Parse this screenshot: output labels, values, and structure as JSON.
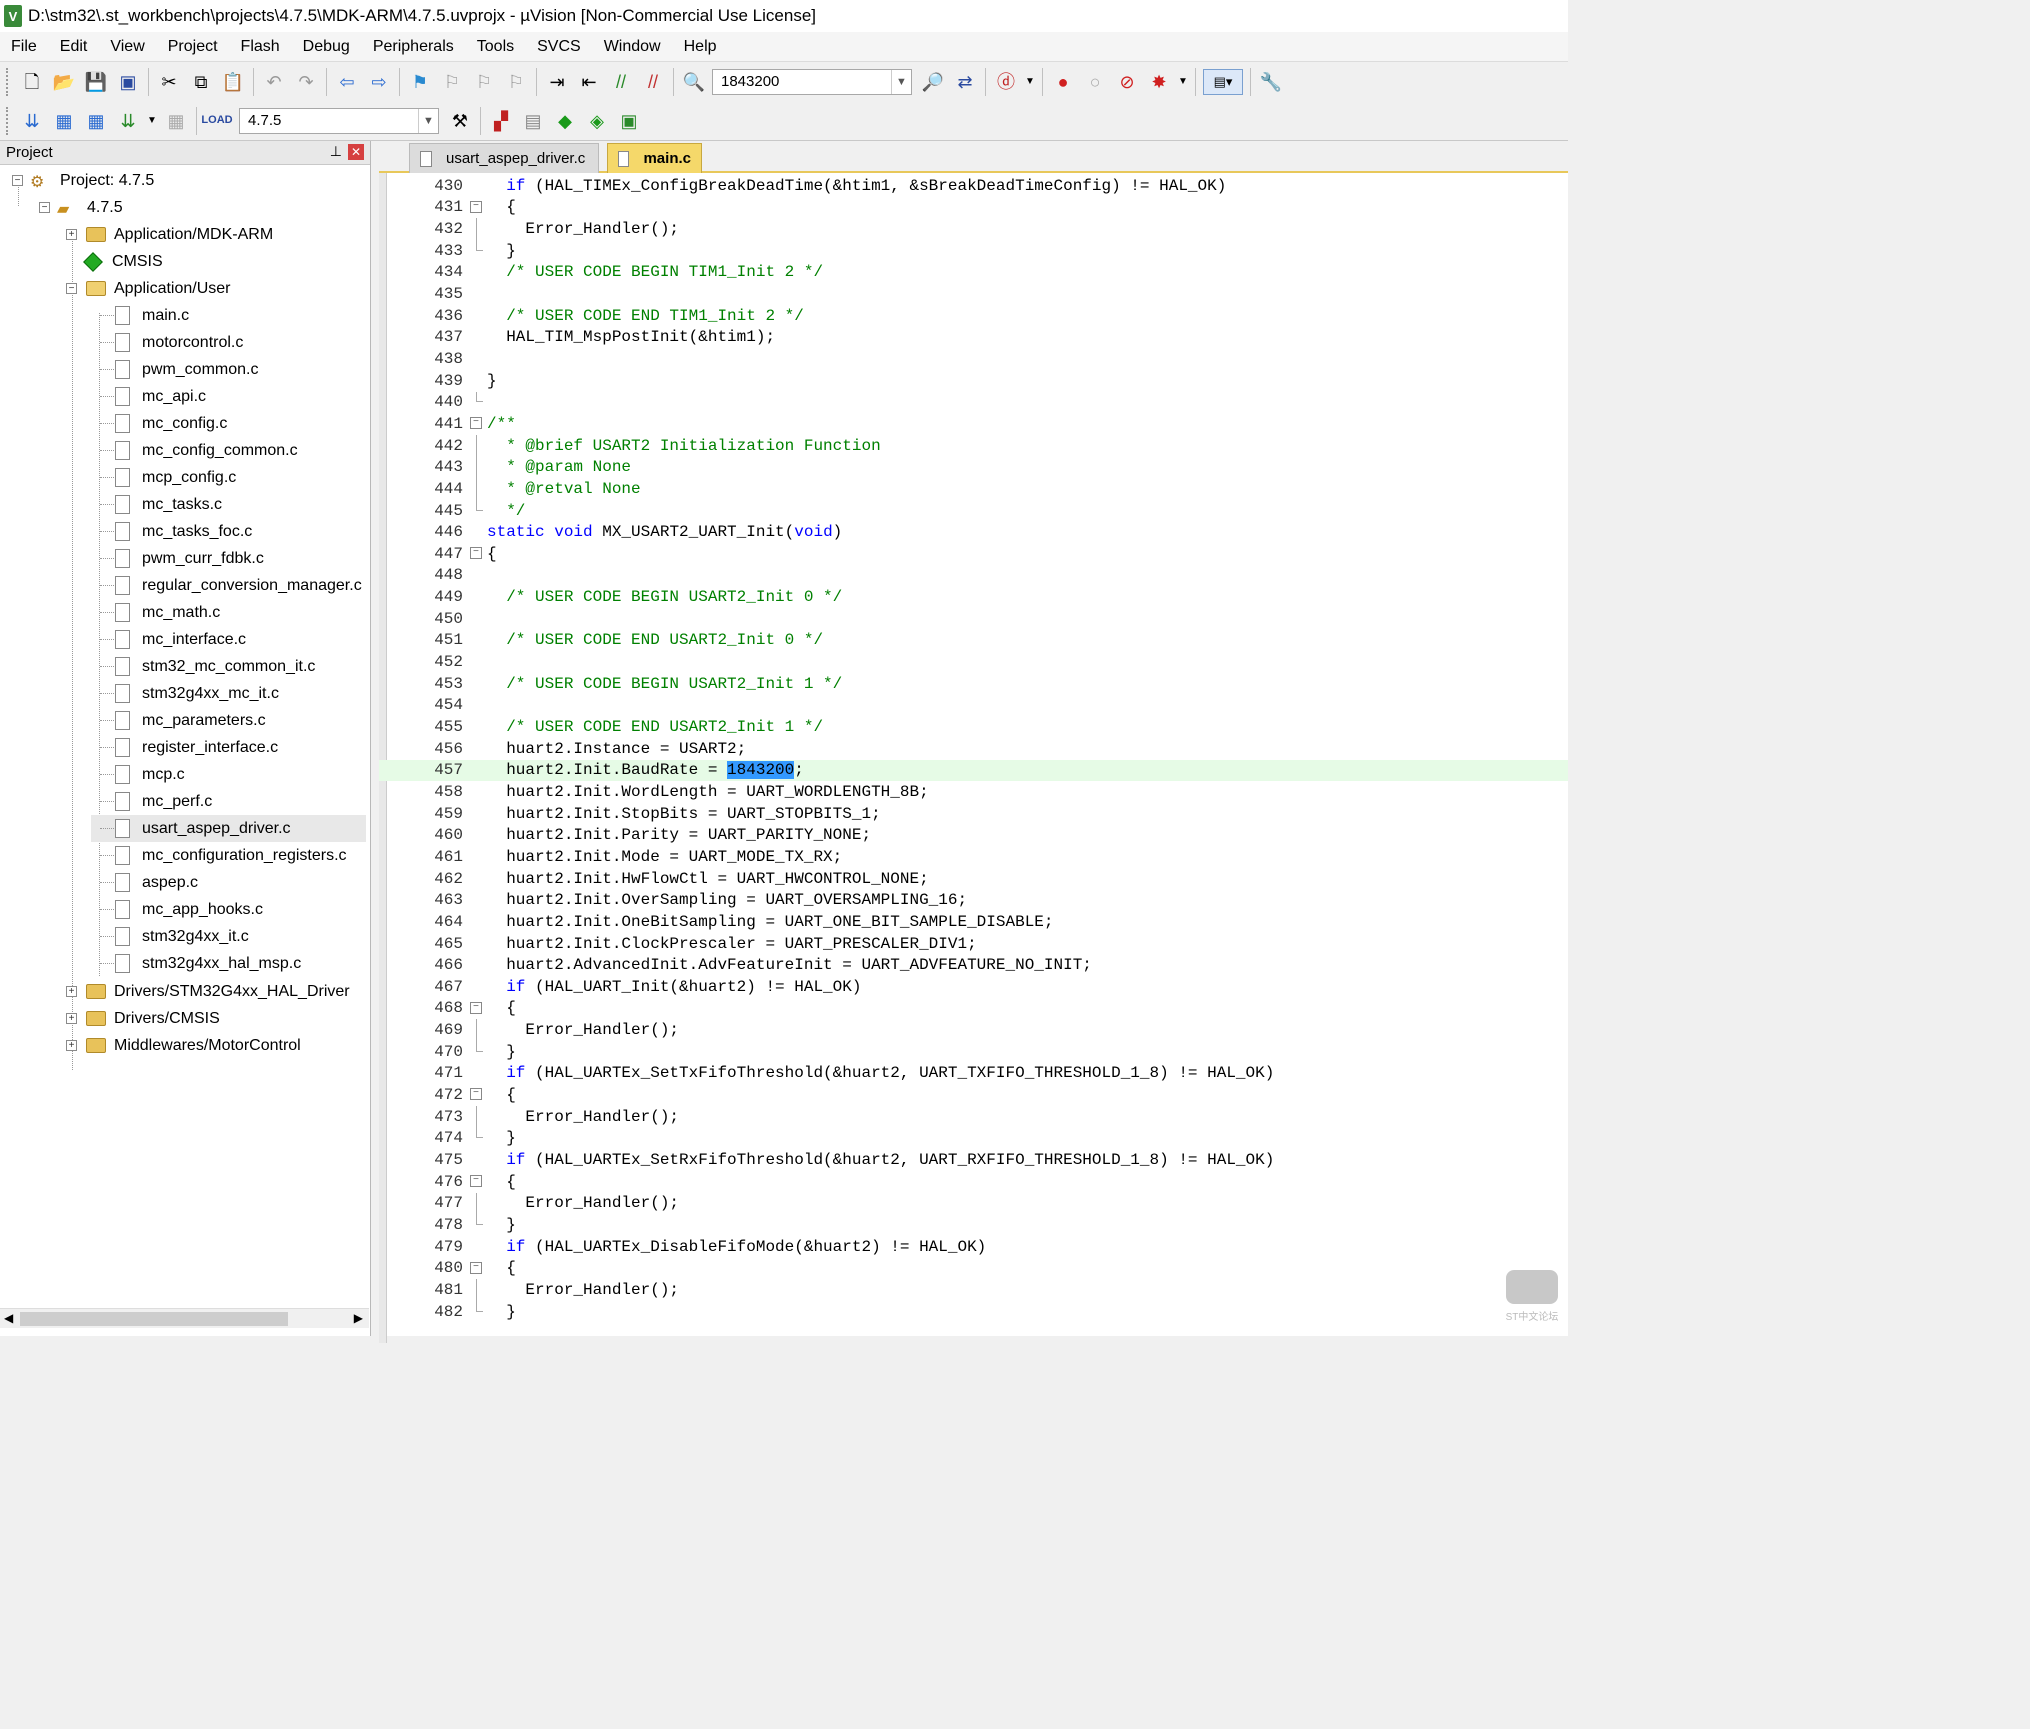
{
  "window": {
    "title": "D:\\stm32\\.st_workbench\\projects\\4.7.5\\MDK-ARM\\4.7.5.uvprojx - µVision  [Non-Commercial Use License]"
  },
  "menu": [
    "File",
    "Edit",
    "View",
    "Project",
    "Flash",
    "Debug",
    "Peripherals",
    "Tools",
    "SVCS",
    "Window",
    "Help"
  ],
  "toolbar": {
    "find_combo": "1843200",
    "target_combo": "4.7.5"
  },
  "project_panel": {
    "title": "Project",
    "root": "Project: 4.7.5",
    "target": "4.7.5",
    "groups": [
      "Application/MDK-ARM",
      "CMSIS",
      "Application/User",
      "Drivers/STM32G4xx_HAL_Driver",
      "Drivers/CMSIS",
      "Middlewares/MotorControl"
    ],
    "files": [
      "main.c",
      "motorcontrol.c",
      "pwm_common.c",
      "mc_api.c",
      "mc_config.c",
      "mc_config_common.c",
      "mcp_config.c",
      "mc_tasks.c",
      "mc_tasks_foc.c",
      "pwm_curr_fdbk.c",
      "regular_conversion_manager.c",
      "mc_math.c",
      "mc_interface.c",
      "stm32_mc_common_it.c",
      "stm32g4xx_mc_it.c",
      "mc_parameters.c",
      "register_interface.c",
      "mcp.c",
      "mc_perf.c",
      "usart_aspep_driver.c",
      "mc_configuration_registers.c",
      "aspep.c",
      "mc_app_hooks.c",
      "stm32g4xx_it.c",
      "stm32g4xx_hal_msp.c"
    ]
  },
  "tabs": [
    "usart_aspep_driver.c",
    "main.c"
  ],
  "code": [
    {
      "n": "430",
      "t": "  if (HAL_TIMEx_ConfigBreakDeadTime(&htim1, &sBreakDeadTimeConfig) != HAL_OK)"
    },
    {
      "n": "431",
      "t": "  {"
    },
    {
      "n": "432",
      "t": "    Error_Handler();"
    },
    {
      "n": "433",
      "t": "  }"
    },
    {
      "n": "434",
      "t": "  /* USER CODE BEGIN TIM1_Init 2 */"
    },
    {
      "n": "435",
      "t": ""
    },
    {
      "n": "436",
      "t": "  /* USER CODE END TIM1_Init 2 */"
    },
    {
      "n": "437",
      "t": "  HAL_TIM_MspPostInit(&htim1);"
    },
    {
      "n": "438",
      "t": ""
    },
    {
      "n": "439",
      "t": "}"
    },
    {
      "n": "440",
      "t": ""
    },
    {
      "n": "441",
      "t": "/**"
    },
    {
      "n": "442",
      "t": "  * @brief USART2 Initialization Function"
    },
    {
      "n": "443",
      "t": "  * @param None"
    },
    {
      "n": "444",
      "t": "  * @retval None"
    },
    {
      "n": "445",
      "t": "  */"
    },
    {
      "n": "446",
      "t": "static void MX_USART2_UART_Init(void)"
    },
    {
      "n": "447",
      "t": "{"
    },
    {
      "n": "448",
      "t": ""
    },
    {
      "n": "449",
      "t": "  /* USER CODE BEGIN USART2_Init 0 */"
    },
    {
      "n": "450",
      "t": ""
    },
    {
      "n": "451",
      "t": "  /* USER CODE END USART2_Init 0 */"
    },
    {
      "n": "452",
      "t": ""
    },
    {
      "n": "453",
      "t": "  /* USER CODE BEGIN USART2_Init 1 */"
    },
    {
      "n": "454",
      "t": ""
    },
    {
      "n": "455",
      "t": "  /* USER CODE END USART2_Init 1 */"
    },
    {
      "n": "456",
      "t": "  huart2.Instance = USART2;"
    },
    {
      "n": "457",
      "t": "  huart2.Init.BaudRate = 1843200;"
    },
    {
      "n": "458",
      "t": "  huart2.Init.WordLength = UART_WORDLENGTH_8B;"
    },
    {
      "n": "459",
      "t": "  huart2.Init.StopBits = UART_STOPBITS_1;"
    },
    {
      "n": "460",
      "t": "  huart2.Init.Parity = UART_PARITY_NONE;"
    },
    {
      "n": "461",
      "t": "  huart2.Init.Mode = UART_MODE_TX_RX;"
    },
    {
      "n": "462",
      "t": "  huart2.Init.HwFlowCtl = UART_HWCONTROL_NONE;"
    },
    {
      "n": "463",
      "t": "  huart2.Init.OverSampling = UART_OVERSAMPLING_16;"
    },
    {
      "n": "464",
      "t": "  huart2.Init.OneBitSampling = UART_ONE_BIT_SAMPLE_DISABLE;"
    },
    {
      "n": "465",
      "t": "  huart2.Init.ClockPrescaler = UART_PRESCALER_DIV1;"
    },
    {
      "n": "466",
      "t": "  huart2.AdvancedInit.AdvFeatureInit = UART_ADVFEATURE_NO_INIT;"
    },
    {
      "n": "467",
      "t": "  if (HAL_UART_Init(&huart2) != HAL_OK)"
    },
    {
      "n": "468",
      "t": "  {"
    },
    {
      "n": "469",
      "t": "    Error_Handler();"
    },
    {
      "n": "470",
      "t": "  }"
    },
    {
      "n": "471",
      "t": "  if (HAL_UARTEx_SetTxFifoThreshold(&huart2, UART_TXFIFO_THRESHOLD_1_8) != HAL_OK)"
    },
    {
      "n": "472",
      "t": "  {"
    },
    {
      "n": "473",
      "t": "    Error_Handler();"
    },
    {
      "n": "474",
      "t": "  }"
    },
    {
      "n": "475",
      "t": "  if (HAL_UARTEx_SetRxFifoThreshold(&huart2, UART_RXFIFO_THRESHOLD_1_8) != HAL_OK)"
    },
    {
      "n": "476",
      "t": "  {"
    },
    {
      "n": "477",
      "t": "    Error_Handler();"
    },
    {
      "n": "478",
      "t": "  }"
    },
    {
      "n": "479",
      "t": "  if (HAL_UARTEx_DisableFifoMode(&huart2) != HAL_OK)"
    },
    {
      "n": "480",
      "t": "  {"
    },
    {
      "n": "481",
      "t": "    Error_Handler();"
    },
    {
      "n": "482",
      "t": "  }"
    }
  ],
  "watermark": "ST中文论坛",
  "colors": {
    "keyword": "#0000ff",
    "comment": "#008000",
    "selection": "#3399ff",
    "current_line": "#e6fbe6",
    "active_tab": "#f5d86a"
  }
}
